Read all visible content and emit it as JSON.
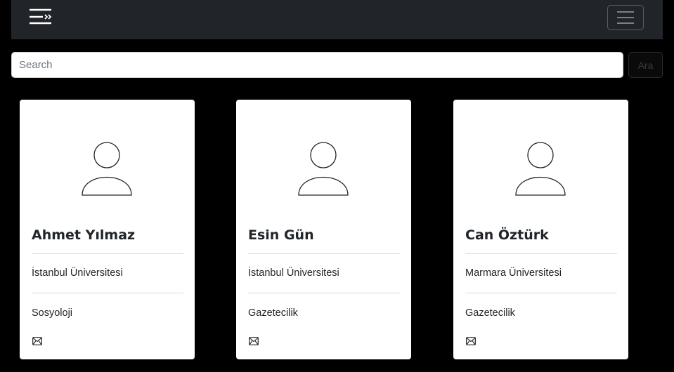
{
  "navbar": {
    "brand_icon": "list-nested-icon",
    "toggler_icon": "hamburger-icon"
  },
  "search": {
    "placeholder": "Search",
    "value": "",
    "button_label": "Ara"
  },
  "cards": [
    {
      "name": "Ahmet Yılmaz",
      "university": "İstanbul Üniversitesi",
      "department": "Sosyoloji",
      "avatar_icon": "person-icon",
      "contact_icon": "envelope-icon"
    },
    {
      "name": "Esin Gün",
      "university": "İstanbul Üniversitesi",
      "department": "Gazetecilik",
      "avatar_icon": "person-icon",
      "contact_icon": "envelope-icon"
    },
    {
      "name": "Can Öztürk",
      "university": "Marmara Üniversitesi",
      "department": "Gazetecilik",
      "avatar_icon": "person-icon",
      "contact_icon": "envelope-icon"
    }
  ],
  "colors": {
    "page_background": "#000000",
    "navbar_background": "#212529",
    "card_background": "#ffffff",
    "text": "#212529"
  }
}
